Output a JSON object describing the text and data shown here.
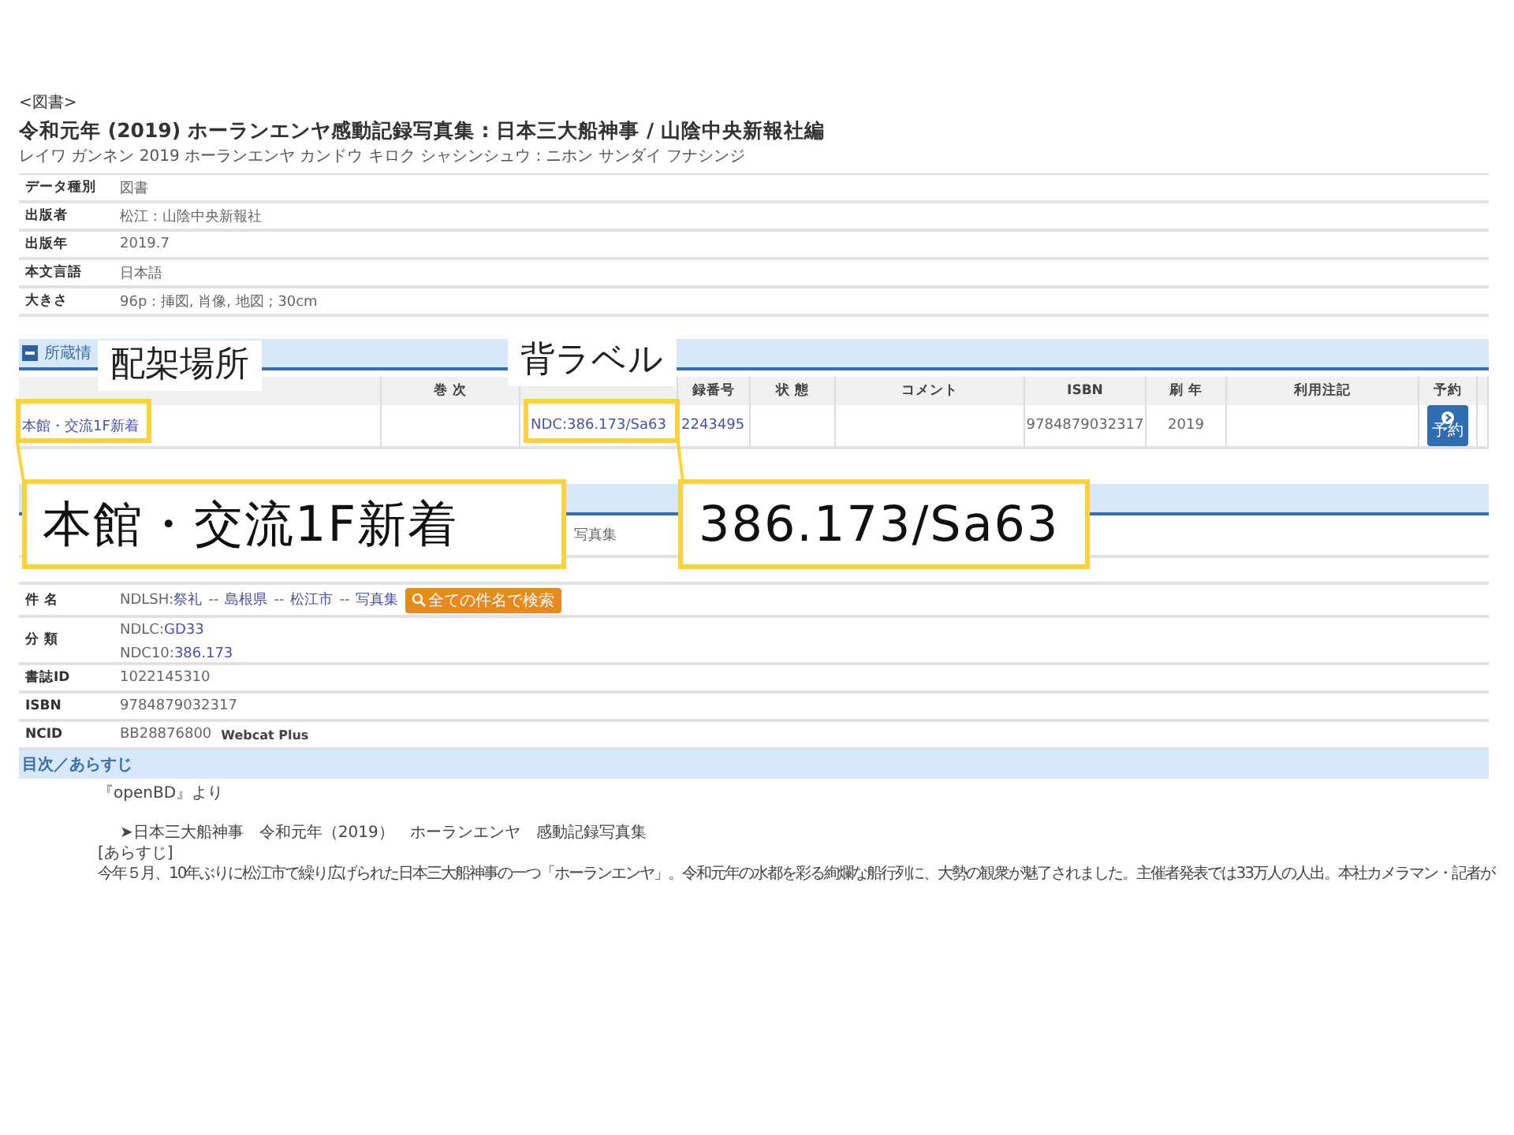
{
  "category": "<図書>",
  "title": "令和元年 (2019) ホーランエンヤ感動記録写真集 : 日本三大船神事 / 山陰中央新報社編",
  "title_reading": "レイワ ガンネン 2019 ホーランエンヤ カンドウ キロク シャシンシュウ : ニホン サンダイ フナシンジ",
  "info_rows": [
    {
      "label": "データ種別",
      "value": "図書"
    },
    {
      "label": "出版者",
      "value": "松江 : 山陰中央新報社"
    },
    {
      "label": "出版年",
      "value": "2019.7"
    },
    {
      "label": "本文言語",
      "value": "日本語"
    },
    {
      "label": "大きさ",
      "value": "96p : 挿図, 肖像, 地図 ; 30cm"
    }
  ],
  "holdings": {
    "section_title": "所蔵情",
    "expanded": true,
    "columns": [
      "",
      "巻 次",
      "",
      "録番号",
      "状 態",
      "コメント",
      "ISBN",
      "刷 年",
      "利用注記",
      "予約",
      ""
    ],
    "row": {
      "location": "本館・交流1F新着",
      "call_number": "NDC:386.173/Sa63",
      "register_number": "2243495",
      "isbn": "9784879032317",
      "print_year": "2019",
      "reserve": "予約"
    }
  },
  "partial_row": {
    "value": "写真集"
  },
  "subjects": {
    "label": "件 名",
    "prefix": "NDLSH:",
    "terms": [
      "祭礼",
      "島根県",
      "松江市",
      "写真集"
    ],
    "separator": "--",
    "button": "全ての件名で検索"
  },
  "classification": {
    "label": "分 類",
    "lines": [
      {
        "prefix": "NDLC:",
        "link": "GD33"
      },
      {
        "prefix": "NDC10:",
        "link": "386.173"
      }
    ]
  },
  "id_rows": [
    {
      "label": "書誌ID",
      "value": "1022145310"
    },
    {
      "label": "ISBN",
      "value": "9784879032317"
    }
  ],
  "ncid": {
    "label": "NCID",
    "value": "BB28876800",
    "link": "Webcat Plus"
  },
  "toc": {
    "title": "目次／あらすじ",
    "source": "『openBD』より",
    "heading": "➤日本三大船神事　令和元年（2019）　ホーランエンヤ　感動記録写真集",
    "label": "[あらすじ]",
    "text": "今年５月、10年ぶりに松江市で繰り広げられた日本三大船神事の一つ「ホーランエンヤ」。令和元年の水都を彩る絢爛な船行列に、大勢の観衆が魅了されました。主催者発表では33万人の人出。本社カメラマン・記者が"
  },
  "annotations": [
    {
      "label": "配架場所",
      "callout": "本館・交流1F新着"
    },
    {
      "label": "背ラベル",
      "callout": "386.173/Sa63"
    }
  ]
}
